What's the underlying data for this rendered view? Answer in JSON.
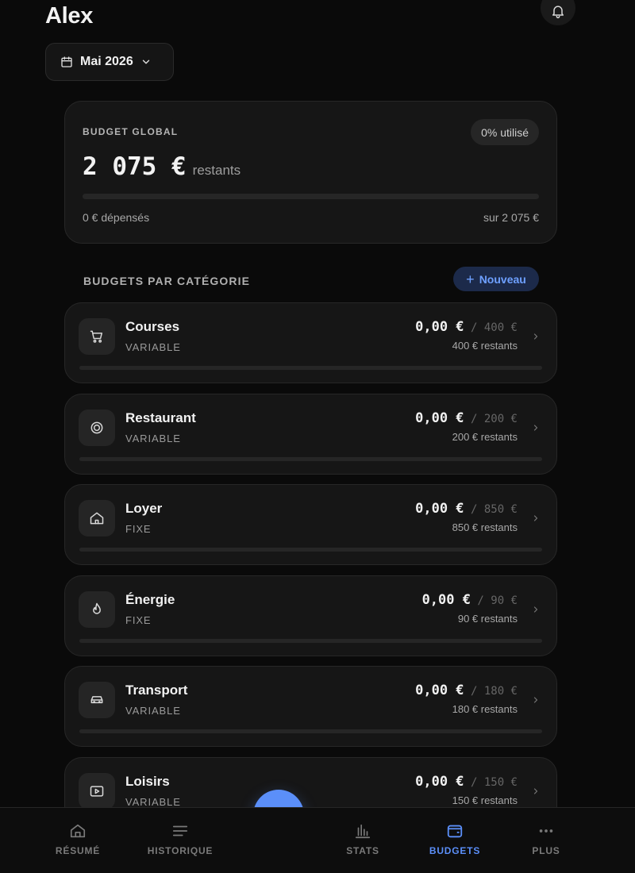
{
  "header": {
    "user_name": "Alex",
    "month_label": "Mai 2026"
  },
  "global_budget": {
    "label": "BUDGET GLOBAL",
    "usage_badge": "0% utilisé",
    "usage_fraction": 0,
    "remaining_amount": "2 075 €",
    "remaining_suffix": "restants",
    "spent_text": "0 € dépensés",
    "total_text": "sur 2 075 €"
  },
  "categories_section": {
    "title": "BUDGETS PAR CATÉGORIE",
    "new_button_label": "Nouveau"
  },
  "categories": [
    {
      "name": "Courses",
      "type": "VARIABLE",
      "spent": "0,00 €",
      "limit": "400 €",
      "remaining": "400 € restants",
      "icon": "cart-icon",
      "usage_fraction": 0
    },
    {
      "name": "Restaurant",
      "type": "VARIABLE",
      "spent": "0,00 €",
      "limit": "200 €",
      "remaining": "200 € restants",
      "icon": "target-icon",
      "usage_fraction": 0
    },
    {
      "name": "Loyer",
      "type": "FIXE",
      "spent": "0,00 €",
      "limit": "850 €",
      "remaining": "850 € restants",
      "icon": "home-icon",
      "usage_fraction": 0
    },
    {
      "name": "Énergie",
      "type": "FIXE",
      "spent": "0,00 €",
      "limit": "90 €",
      "remaining": "90 € restants",
      "icon": "flame-icon",
      "usage_fraction": 0
    },
    {
      "name": "Transport",
      "type": "VARIABLE",
      "spent": "0,00 €",
      "limit": "180 €",
      "remaining": "180 € restants",
      "icon": "car-icon",
      "usage_fraction": 0
    },
    {
      "name": "Loisirs",
      "type": "VARIABLE",
      "spent": "0,00 €",
      "limit": "150 €",
      "remaining": "150 € restants",
      "icon": "play-icon",
      "usage_fraction": 0
    }
  ],
  "nav": {
    "items": [
      {
        "label": "RÉSUMÉ",
        "icon": "home-icon",
        "active": false
      },
      {
        "label": "HISTORIQUE",
        "icon": "list-icon",
        "active": false
      },
      {
        "label": "STATS",
        "icon": "bar-chart-icon",
        "active": false
      },
      {
        "label": "BUDGETS",
        "icon": "wallet-icon",
        "active": true
      },
      {
        "label": "PLUS",
        "icon": "more-icon",
        "active": false
      }
    ]
  },
  "colors": {
    "accent": "#5b8ff9",
    "background": "#0a0a0a",
    "card": "#161616"
  }
}
